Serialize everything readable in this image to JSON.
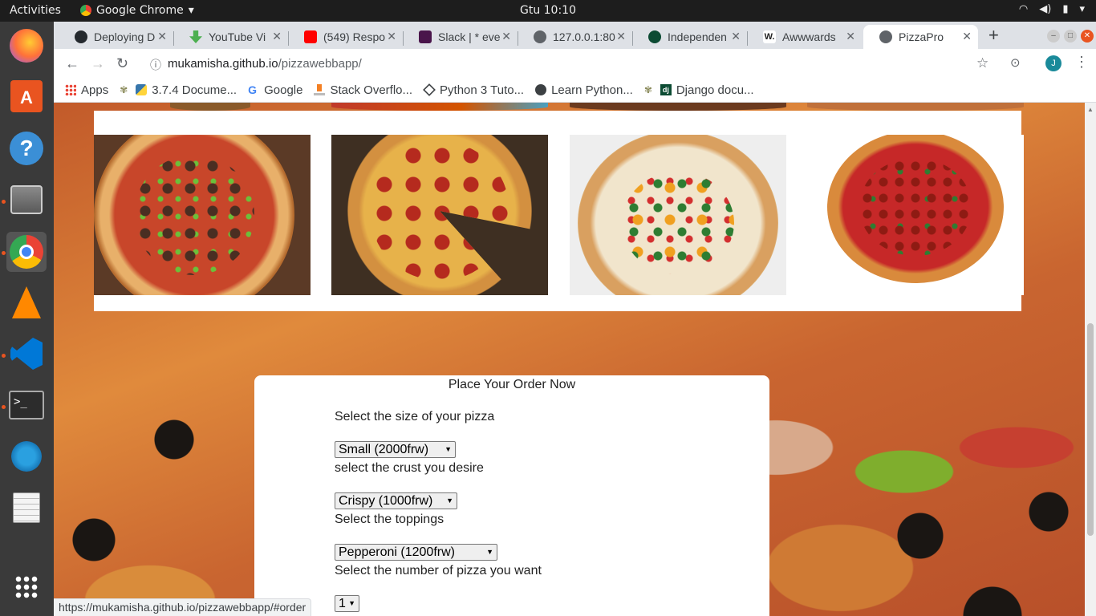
{
  "os": {
    "activities": "Activities",
    "app_name": "Google Chrome",
    "clock": "Gtu 10:10"
  },
  "tabs": [
    {
      "label": "Deploying D",
      "fav_color": "#24292e"
    },
    {
      "label": "YouTube Vi",
      "fav_color": "#4caf50"
    },
    {
      "label": "(549) Respo",
      "fav_color": "#ff0000"
    },
    {
      "label": "Slack | * eve",
      "fav_color": "#4a154b"
    },
    {
      "label": "127.0.0.1:80",
      "fav_color": "#5f6368"
    },
    {
      "label": "Independen",
      "fav_color": "#0c4b33"
    },
    {
      "label": "Awwwards",
      "fav_color": "#222222"
    },
    {
      "label": "PizzaPro",
      "fav_color": "#5f6368",
      "active": true
    }
  ],
  "toolbar": {
    "url_host": "mukamisha.github.io",
    "url_path": "/pizzawebbapp/",
    "avatar_letter": "J"
  },
  "bookmarks": [
    {
      "label": "Apps",
      "icon": "apps-grid-icon"
    },
    {
      "label": "3.7.4 Docume...",
      "icon": "python-icon"
    },
    {
      "label": "Google",
      "icon": "google-icon"
    },
    {
      "label": "Stack Overflo...",
      "icon": "stackoverflow-icon"
    },
    {
      "label": "Python 3 Tuto...",
      "icon": "diamond-icon"
    },
    {
      "label": "Learn Python...",
      "icon": "globe-icon"
    },
    {
      "label": "Django docu...",
      "icon": "django-icon"
    }
  ],
  "order": {
    "heading": "Place Your Order Now",
    "size_label": "Select the size of your pizza",
    "size_value": "Small (2000frw)",
    "crust_label": "select the crust you desire",
    "crust_value": "Crispy (1000frw)",
    "toppings_label": "Select the toppings",
    "toppings_value": "Pepperoni (1200frw)",
    "number_label": "Select the number of pizza you want",
    "number_value": "1"
  },
  "status_url": "https://mukamisha.github.io/pizzawebbapp/#order"
}
